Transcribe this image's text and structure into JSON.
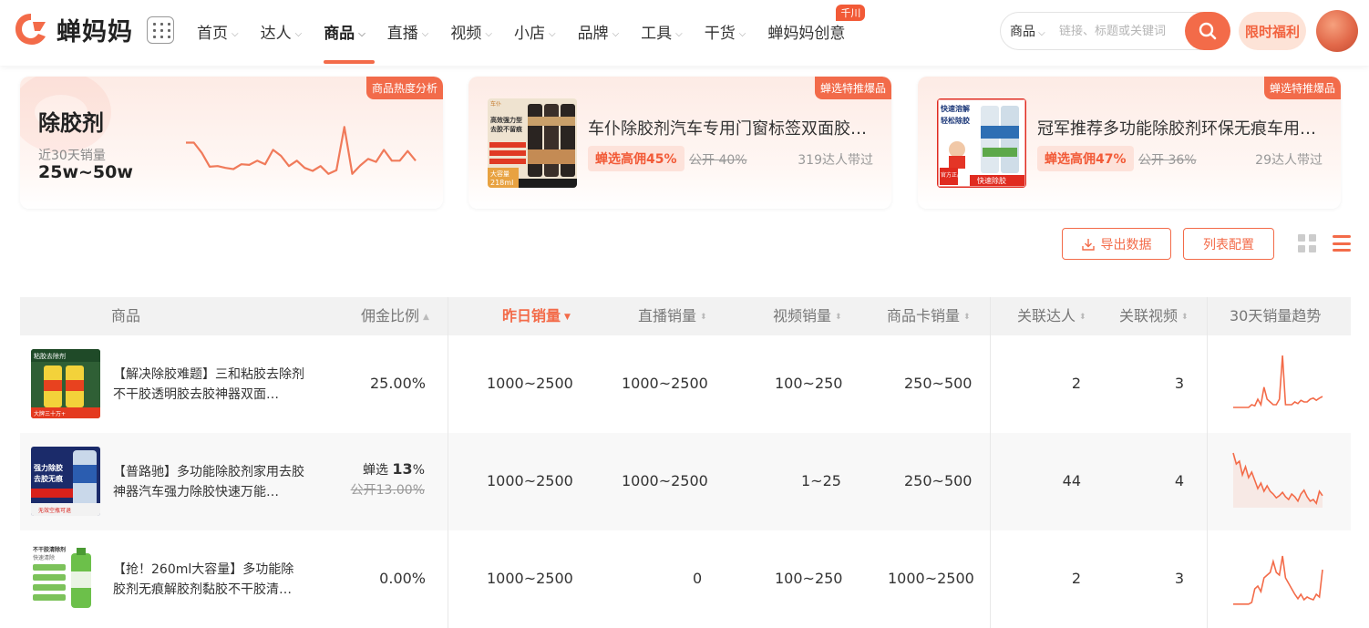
{
  "header": {
    "logo_text": "蝉妈妈",
    "nav": [
      {
        "label": "首页",
        "caret": true
      },
      {
        "label": "达人",
        "caret": true
      },
      {
        "label": "商品",
        "caret": true,
        "active": true
      },
      {
        "label": "直播",
        "caret": true
      },
      {
        "label": "视频",
        "caret": true
      },
      {
        "label": "小店",
        "caret": true
      },
      {
        "label": "品牌",
        "caret": true
      },
      {
        "label": "工具",
        "caret": true
      },
      {
        "label": "干货",
        "caret": true
      },
      {
        "label": "蝉妈妈创意",
        "caret": false,
        "badge": "千川"
      }
    ],
    "search": {
      "type": "商品",
      "placeholder": "链接、标题或关键词"
    },
    "promo": "限时福利"
  },
  "summary_card": {
    "tag": "商品热度分析",
    "keyword": "除胶剂",
    "sales_label": "近30天销量",
    "sales_value": "25w~50w",
    "trend": [
      0.72,
      0.72,
      0.55,
      0.32,
      0.33,
      0.3,
      0.28,
      0.36,
      0.35,
      0.42,
      0.36,
      0.6,
      0.5,
      0.33,
      0.42,
      0.3,
      0.25,
      0.33,
      0.2,
      0.26,
      0.98,
      0.2,
      0.34,
      0.45,
      0.4,
      0.6,
      0.42,
      0.42,
      0.58,
      0.42
    ]
  },
  "featured": [
    {
      "tag": "蝉选特推爆品",
      "title": "车仆除胶剂汽车专用门窗标签双面胶…",
      "commission": "蝉选高佣45%",
      "public": "公开 40%",
      "influencers": "319达人带过",
      "img_texts": [
        "高效强力型",
        "去胶不留痕",
        "大容量",
        "218ml",
        "车仆"
      ]
    },
    {
      "tag": "蝉选特推爆品",
      "title": "冠军推荐多功能除胶剂环保无痕车用…",
      "commission": "蝉选高佣47%",
      "public": "公开 36%",
      "influencers": "29达人带过",
      "img_texts": [
        "快速溶解",
        "轻松除胶",
        "官方正品",
        "快速除胶"
      ]
    }
  ],
  "actions": {
    "export": "导出数据",
    "config": "列表配置"
  },
  "table": {
    "headers": {
      "product": "商品",
      "commission": "佣金比例",
      "yesterday": "昨日销量",
      "live": "直播销量",
      "video": "视频销量",
      "card": "商品卡销量",
      "influencers": "关联达人",
      "videos": "关联视频",
      "trend": "30天销量趋势"
    },
    "rows": [
      {
        "title": "【解决除胶难题】三和粘胶去除剂不干胶透明胶去胶神器双面…",
        "commission": "25.00%",
        "yesterday": "1000~2500",
        "live": "1000~2500",
        "video": "100~250",
        "card": "250~500",
        "influencers": "2",
        "videos": "3",
        "img_texts": [
          "粘胶去除剂",
          "大牌三十万+"
        ],
        "trend": [
          0.05,
          0.05,
          0.05,
          0.05,
          0.05,
          0.05,
          0.1,
          0.08,
          0.2,
          0.1,
          0.42,
          0.2,
          0.15,
          0.1,
          0.1,
          0.2,
          1.0,
          0.1,
          0.1,
          0.1,
          0.15,
          0.12,
          0.18,
          0.15,
          0.15,
          0.2,
          0.22,
          0.18,
          0.22,
          0.25
        ]
      },
      {
        "title": "【普路驰】多功能除胶剂家用去胶神器汽车强力除胶快速万能…",
        "commission_prefix": "蝉选 ",
        "commission_bold": "13",
        "commission_suffix": "%",
        "commission_public": "公开13.00%",
        "yesterday": "1000~2500",
        "live": "1000~2500",
        "video": "1~25",
        "card": "250~500",
        "influencers": "44",
        "videos": "4",
        "img_texts": [
          "强力除胶",
          "去胶无痕",
          "无效空瓶可退"
        ],
        "trend": [
          1.0,
          0.8,
          0.85,
          0.6,
          0.75,
          0.55,
          0.65,
          0.5,
          0.35,
          0.45,
          0.3,
          0.4,
          0.3,
          0.25,
          0.18,
          0.22,
          0.28,
          0.2,
          0.15,
          0.25,
          0.2,
          0.12,
          0.25,
          0.32,
          0.2,
          0.12,
          0.15,
          0.08,
          0.3,
          0.22
        ]
      },
      {
        "title": "【抢！260ml大容量】多功能除胶剂无痕解胶剂黏胶不干胶清…",
        "commission": "0.00%",
        "yesterday": "1000~2500",
        "live": "0",
        "video": "100~250",
        "card": "1000~2500",
        "influencers": "2",
        "videos": "3",
        "img_texts": [
          "不干胶清除剂",
          "快速清除"
        ],
        "trend": [
          0.02,
          0.02,
          0.02,
          0.02,
          0.02,
          0.02,
          0.05,
          0.3,
          0.35,
          0.25,
          0.5,
          0.55,
          0.6,
          0.8,
          0.6,
          0.55,
          0.9,
          0.5,
          0.4,
          0.3,
          0.2,
          0.12,
          0.2,
          0.1,
          0.15,
          0.12,
          0.1,
          0.2,
          0.15,
          0.65
        ]
      }
    ]
  },
  "colors": {
    "accent": "#f36b49",
    "accent_light": "#fde2da",
    "header_bg": "#f2f2f2",
    "row_alt": "#f8f8f8"
  }
}
